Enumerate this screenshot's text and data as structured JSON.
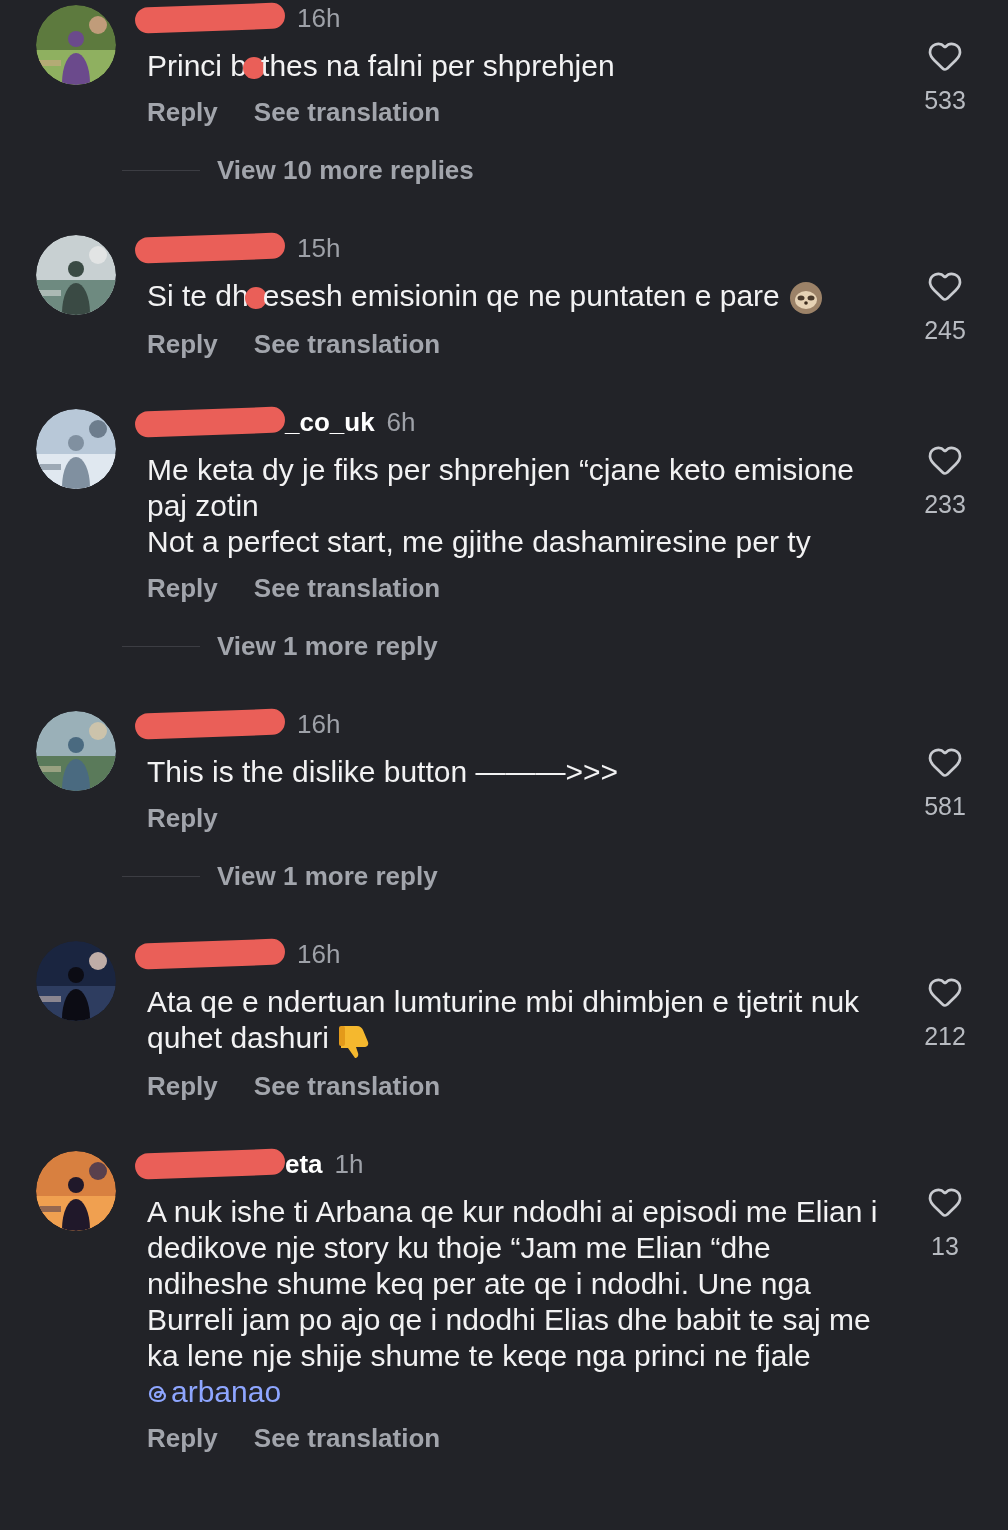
{
  "comments": [
    {
      "time": "16h",
      "text": "Princi b",
      "text_after_mark": "thes na falni per shprehjen",
      "actions": [
        "Reply",
        "See translation"
      ],
      "likes": "533",
      "view_more": "View 10 more replies"
    },
    {
      "time": "15h",
      "text": "Si te dh",
      "text_after_mark": "esesh emisionin qe ne puntaten e pare",
      "trailing_icon": {
        "kind": "sloth"
      },
      "actions": [
        "Reply",
        "See translation"
      ],
      "likes": "245"
    },
    {
      "username_visible": "_co_uk",
      "time": "6h",
      "text": "Me keta dy je fiks per shprehjen “cjane keto emisione paj zotin\nNot a perfect start, me gjithe dashamiresine per ty",
      "actions": [
        "Reply",
        "See translation"
      ],
      "likes": "233",
      "view_more": "View 1 more reply"
    },
    {
      "time": "16h",
      "text": "This is the dislike button ———>>>",
      "actions": [
        "Reply"
      ],
      "likes": "581",
      "view_more": "View 1 more reply"
    },
    {
      "time": "16h",
      "text": "Ata qe e ndertuan lumturine mbi dhimbjen e tjetrit nuk quhet dashuri",
      "trailing_icon": {
        "kind": "thumbs-down"
      },
      "actions": [
        "Reply",
        "See translation"
      ],
      "likes": "212"
    },
    {
      "username_visible": "eta",
      "time": "1h",
      "text": "A nuk ishe ti Arbana qe kur ndodhi ai episodi me Elian i dedikove nje story ku thoje “Jam me Elian “dhe ndiheshe shume keq per ate qe i ndodhi. Une nga Burreli jam po ajo qe i ndodhi Elias dhe babit te saj me ka lene nje shije shume te keqe nga princi ne fjale",
      "mention": "arbanao",
      "actions": [
        "Reply",
        "See translation"
      ],
      "likes": "13"
    }
  ]
}
